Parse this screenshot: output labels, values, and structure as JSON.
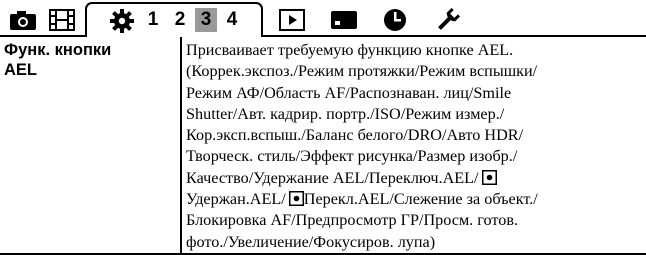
{
  "tabs": {
    "icons": [
      "camera-icon",
      "movie-icon",
      "gear-icon",
      "playback-icon",
      "network-icon",
      "clock-icon",
      "wrench-icon"
    ],
    "page_numbers": [
      "1",
      "2",
      "3",
      "4"
    ],
    "selected_page": "3"
  },
  "row": {
    "label_line1": "Функ. кнопки",
    "label_line2": "AEL",
    "desc_lines": [
      "Присваивает требуемую функцию кнопке AEL.",
      "(Коррек.экспоз./Режим протяжки/Режим вспышки/",
      "Режим АФ/Область AF/Распознаван. лиц/Smile",
      "Shutter/Авт. кадрир. портр./ISO/Режим измер./",
      "Кор.эксп.вспыш./Баланс белого/DRO/Авто HDR/",
      "Творческ. стиль/Эффект рисунка/Размер изобр./",
      "Качество/Удержание AEL/Переключ.AEL/",
      "Удержан.AEL/",
      "Перекл.AEL/Слежение за объект./",
      "Блокировка AF/Предпросмотр ГР/Просм. готов.",
      "фото./Увеличение/Фокусиров. лупа)"
    ]
  }
}
